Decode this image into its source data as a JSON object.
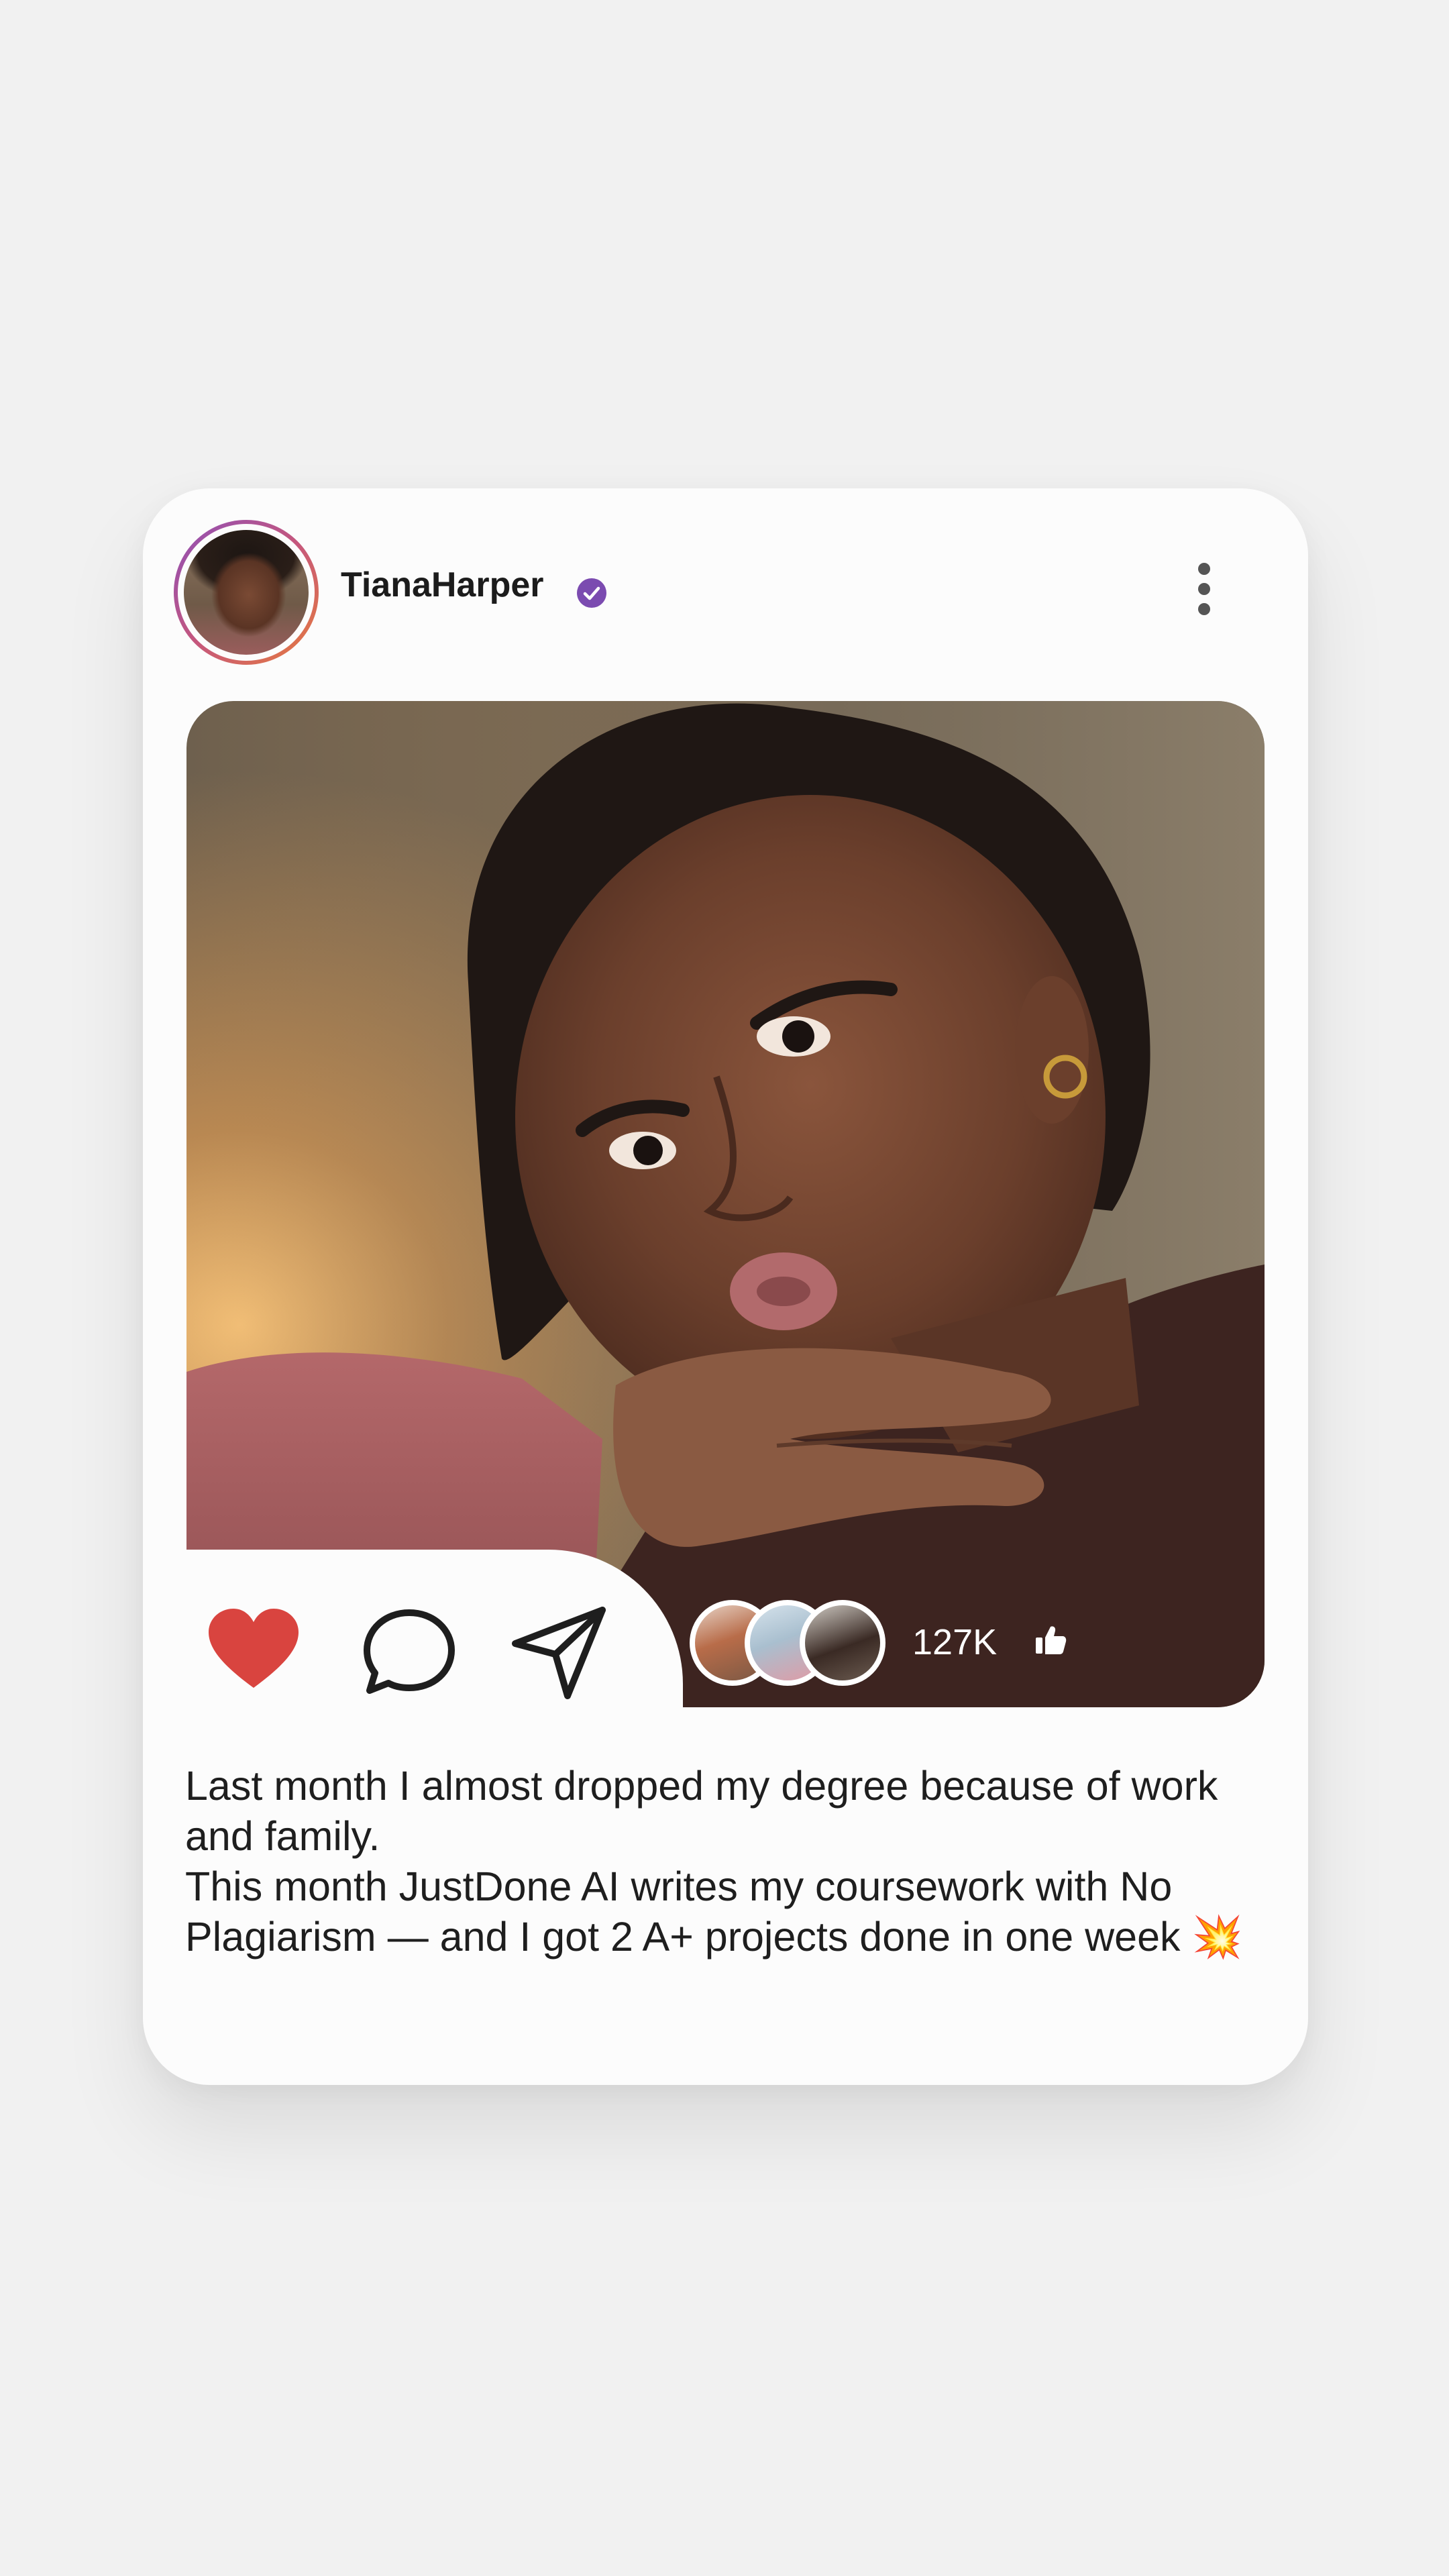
{
  "post": {
    "username": "TianaHarper",
    "verified": true,
    "likes": "127K",
    "caption_lines": [
      "Last month I almost dropped my degree because of work and family.",
      "This month JustDone AI writes my coursework with No Plagiarism — and I got 2 A+ projects done in one week 💥"
    ]
  },
  "icons": {
    "verified": "verified-badge-icon",
    "more": "more-vertical-icon",
    "like": "heart-icon",
    "comment": "comment-bubble-icon",
    "share": "send-arrow-icon",
    "thumb": "thumbs-up-icon"
  },
  "colors": {
    "verified_badge": "#7b4bb0",
    "heart": "#d9443f",
    "avatar_ring_start": "#8e4fb8",
    "avatar_ring_end": "#e77b3b",
    "card_background": "#fcfcfc",
    "page_background": "#f1f1f1"
  }
}
